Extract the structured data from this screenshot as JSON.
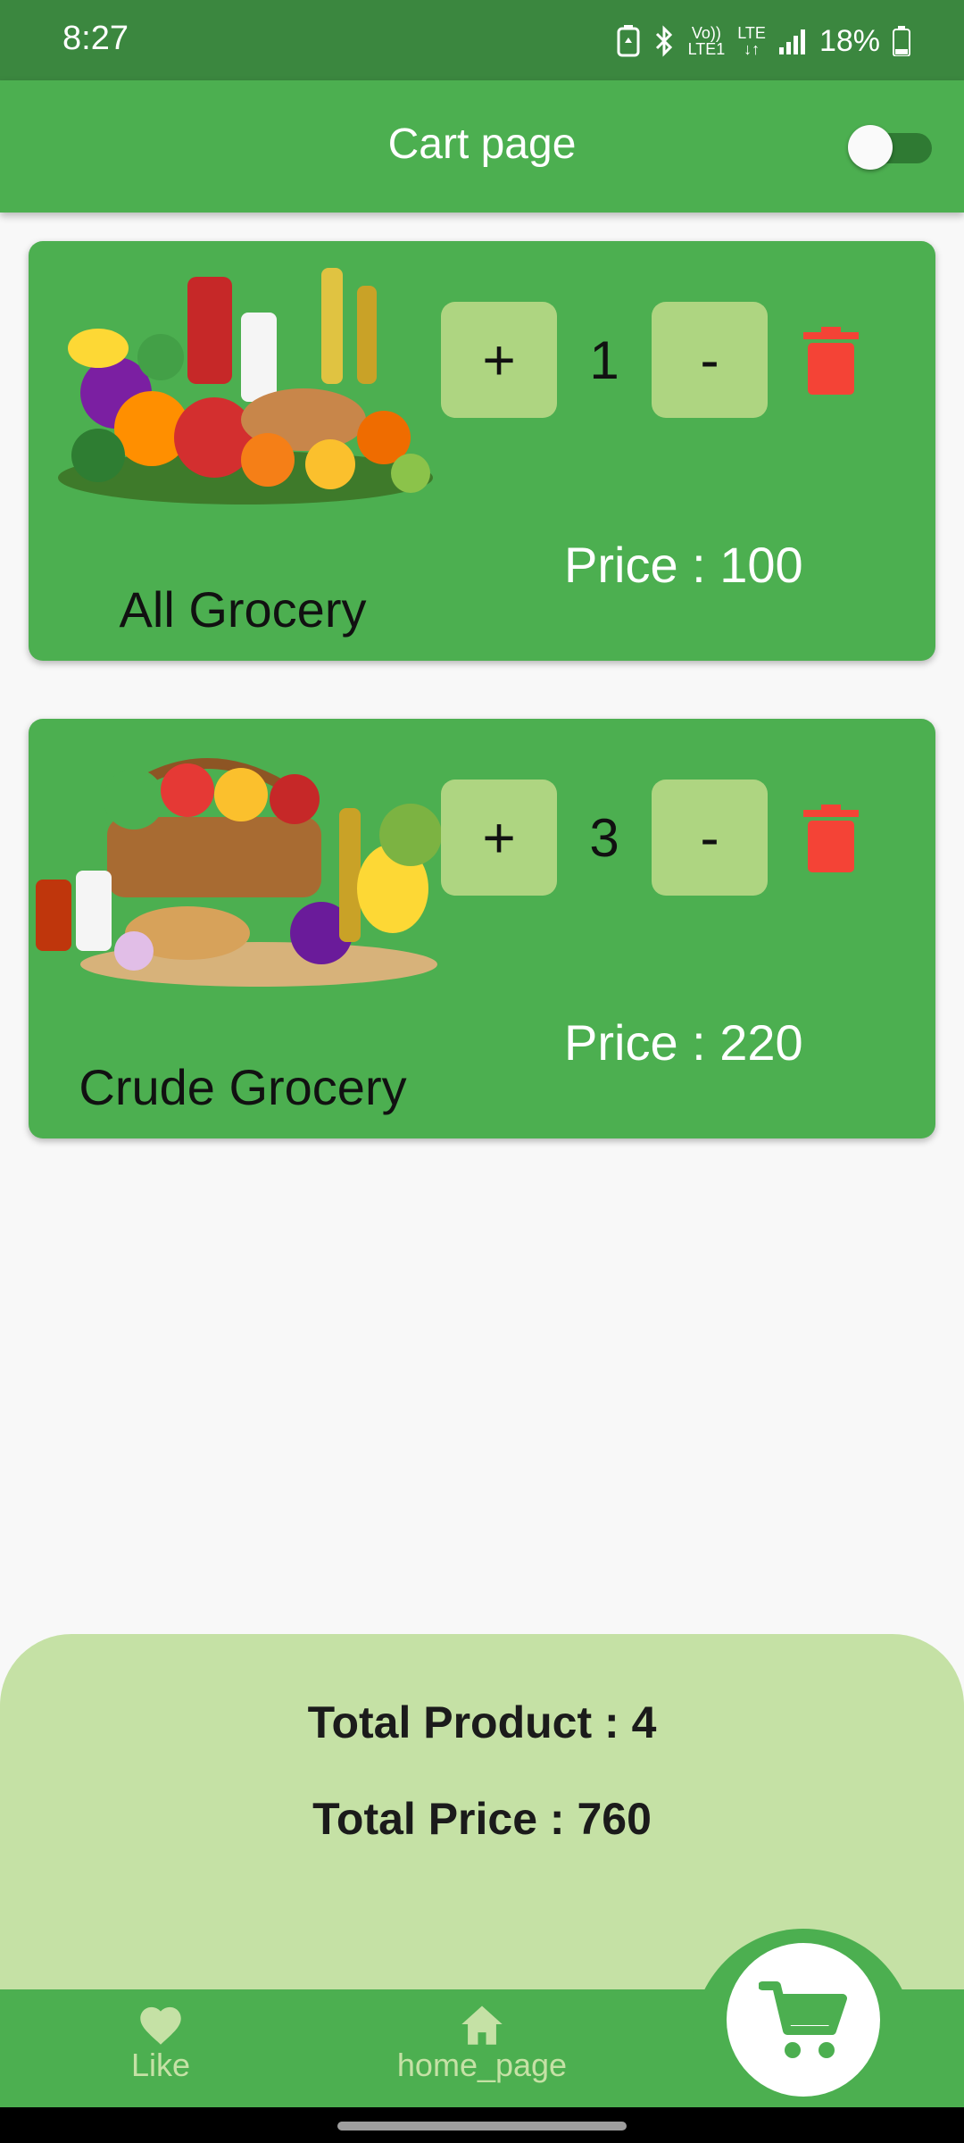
{
  "status_bar": {
    "time": "8:27",
    "network_top": "Vo))",
    "network_bottom": "LTE1",
    "lte": "LTE",
    "battery": "18%"
  },
  "app_bar": {
    "title": "Cart page",
    "toggle_on": false
  },
  "cart_items": [
    {
      "name": "All Grocery",
      "quantity": "1",
      "price": "Price : 100",
      "plus": "+",
      "minus": "-"
    },
    {
      "name": "Crude Grocery",
      "quantity": "3",
      "price": "Price : 220",
      "plus": "+",
      "minus": "-"
    }
  ],
  "summary": {
    "total_product": "Total Product : 4",
    "total_price": "Total Price : 760"
  },
  "bottom_nav": {
    "like_label": "Like",
    "home_label": "home_page",
    "like_icon": "heart-icon",
    "home_icon": "home-icon",
    "cart_icon": "cart-icon"
  },
  "colors": {
    "primary": "#4caf50",
    "status_bar": "#3b873f",
    "button": "#aed581",
    "summary": "#c5e1a5",
    "delete": "#f44336"
  }
}
